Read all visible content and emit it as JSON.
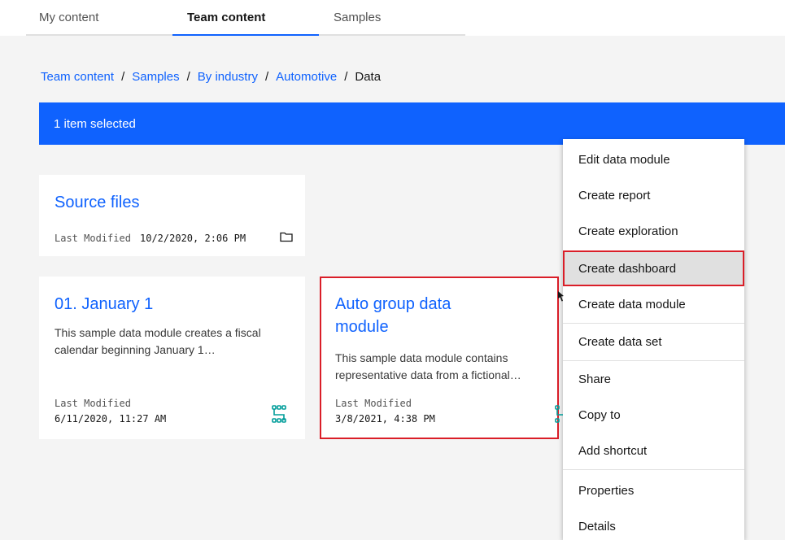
{
  "tabs": [
    {
      "label": "My content",
      "active": false
    },
    {
      "label": "Team content",
      "active": true
    },
    {
      "label": "Samples",
      "active": false
    }
  ],
  "breadcrumb": {
    "links": [
      "Team content",
      "Samples",
      "By industry",
      "Automotive"
    ],
    "separator": "/",
    "current": "Data"
  },
  "selection_bar": {
    "text": "1 item selected"
  },
  "cards": {
    "source": {
      "title": "Source files",
      "modified_label": "Last Modified",
      "modified_value": "10/2/2020, 2:06 PM",
      "icon": "folder-icon"
    },
    "january": {
      "title": "01. January 1",
      "description": "This sample data module creates a fiscal calendar beginning January 1…",
      "modified_label": "Last Modified",
      "modified_value": "6/11/2020, 11:27 AM",
      "icon": "data-module-icon"
    },
    "auto": {
      "title_line1": "Auto group data",
      "title_line2": "module",
      "description_line1": "This sample data module contains",
      "description_line2": "representative data from a fictional…",
      "modified_label": "Last Modified",
      "modified_value": "3/8/2021, 4:38 PM",
      "icon": "data-module-icon"
    }
  },
  "context_menu": {
    "items": [
      "Edit data module",
      "Create report",
      "Create exploration",
      "Create dashboard",
      "Create data module",
      "Create data set",
      "Share",
      "Copy to",
      "Add shortcut",
      "Properties",
      "Details"
    ],
    "highlighted": "Create dashboard"
  },
  "colors": {
    "accent": "#0f62fe",
    "highlight_border": "#da1e28",
    "icon_teal": "#009d9a"
  }
}
